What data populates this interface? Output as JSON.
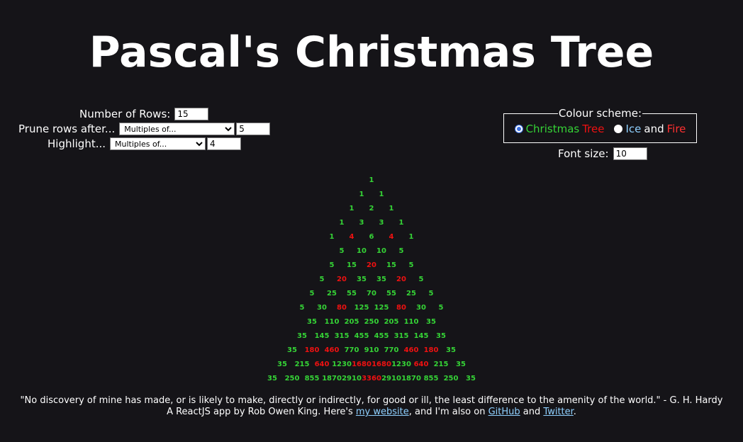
{
  "title": "Pascal's Christmas Tree",
  "controls": {
    "rows_label": "Number of Rows:",
    "rows_value": "15",
    "prune_label": "Prune rows after...",
    "prune_select": "Multiples of...",
    "prune_value": "5",
    "highlight_label": "Highlight...",
    "highlight_select": "Multiples of...",
    "highlight_value": "4"
  },
  "colour_scheme": {
    "legend": "Colour scheme:",
    "opt1_word1": "Christmas",
    "opt1_word2": "Tree",
    "opt2_word1": "Ice",
    "opt2_and": "and",
    "opt2_word2": "Fire",
    "selected": "Christmas Tree"
  },
  "font_size": {
    "label": "Font size:",
    "value": "10"
  },
  "colors": {
    "background": "#151418",
    "normal": "#35d336",
    "highlight": "#ee1111",
    "link": "#8fd0ff"
  },
  "tree": [
    [
      1
    ],
    [
      1,
      1
    ],
    [
      1,
      2,
      1
    ],
    [
      1,
      3,
      3,
      1
    ],
    [
      1,
      4,
      6,
      4,
      1
    ],
    [
      5,
      10,
      10,
      5
    ],
    [
      5,
      15,
      20,
      15,
      5
    ],
    [
      5,
      20,
      35,
      35,
      20,
      5
    ],
    [
      5,
      25,
      55,
      70,
      55,
      25,
      5
    ],
    [
      5,
      30,
      80,
      125,
      125,
      80,
      30,
      5
    ],
    [
      35,
      110,
      205,
      250,
      205,
      110,
      35
    ],
    [
      35,
      145,
      315,
      455,
      455,
      315,
      145,
      35
    ],
    [
      35,
      180,
      460,
      770,
      910,
      770,
      460,
      180,
      35
    ],
    [
      35,
      215,
      640,
      1230,
      1680,
      1680,
      1230,
      640,
      215,
      35
    ],
    [
      35,
      250,
      855,
      1870,
      2910,
      3360,
      2910,
      1870,
      855,
      250,
      35
    ]
  ],
  "footer": {
    "quote": "\"No discovery of mine has made, or is likely to make, directly or indirectly, for good or ill, the least difference to the amenity of the world.\" - G. H. Hardy",
    "credit_prefix": "A ReactJS app by Rob Owen King. Here's",
    "website_link": "my website",
    "credit_middle": ", and I'm also on",
    "github_link": "GitHub",
    "and": "and",
    "twitter_link": "Twitter",
    "end": "."
  }
}
